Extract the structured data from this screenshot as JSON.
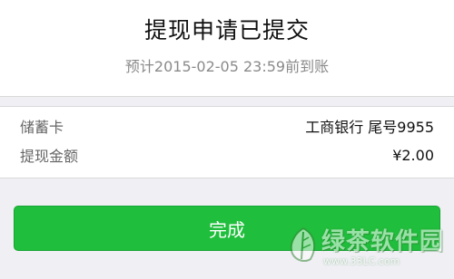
{
  "header": {
    "title": "提现申请已提交",
    "subtitle": "预计2015-02-05 23:59前到账"
  },
  "details": {
    "rows": [
      {
        "label": "储蓄卡",
        "value": "工商银行 尾号9955"
      },
      {
        "label": "提现金额",
        "value": "¥2.00"
      }
    ]
  },
  "actions": {
    "done_label": "完成"
  },
  "watermark": {
    "text": "绿茶软件园",
    "url": "www.33LC.com"
  },
  "colors": {
    "primary_button": "#1fbe3c",
    "background": "#efeff4"
  }
}
